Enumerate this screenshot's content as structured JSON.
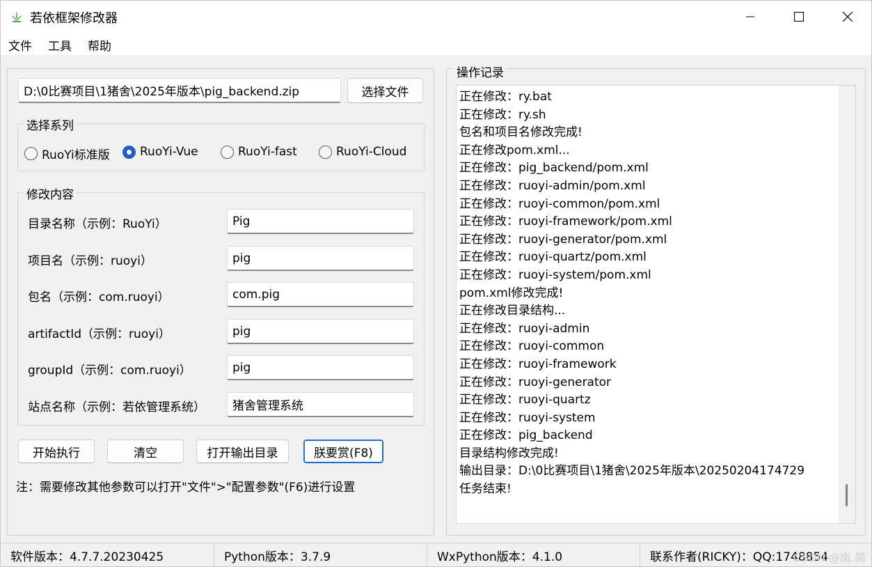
{
  "window": {
    "title": "若依框架修改器"
  },
  "menu": [
    "文件",
    "工具",
    "帮助"
  ],
  "file_path": "D:\\0比赛项目\\1猪舍\\2025年版本\\pig_backend.zip",
  "select_file_button": "选择文件",
  "series": {
    "legend": "选择系列",
    "options": [
      "RuoYi标准版",
      "RuoYi-Vue",
      "RuoYi-fast",
      "RuoYi-Cloud"
    ],
    "selected": "RuoYi-Vue"
  },
  "modify": {
    "legend": "修改内容",
    "fields": [
      {
        "label": "目录名称（示例：RuoYi）",
        "value": "Pig"
      },
      {
        "label": "项目名（示例：ruoyi）",
        "value": "pig"
      },
      {
        "label": "包名（示例：com.ruoyi）",
        "value": "com.pig"
      },
      {
        "label": "artifactId（示例：ruoyi）",
        "value": "pig"
      },
      {
        "label": "groupId（示例：com.ruoyi）",
        "value": "pig"
      },
      {
        "label": "站点名称（示例：若依管理系统）",
        "value": "猪舍管理系统"
      }
    ]
  },
  "actions": {
    "start": "开始执行",
    "clear": "清空",
    "open_output": "打开输出目录",
    "donate": "朕要赏(F8)"
  },
  "note": "注：需要修改其他参数可以打开\"文件\">\"配置参数\"(F6)进行设置",
  "log": {
    "legend": "操作记录",
    "lines": [
      "正在修改：ry.bat",
      "正在修改：ry.sh",
      "包名和项目名修改完成!",
      "正在修改pom.xml...",
      "正在修改：pig_backend/pom.xml",
      "正在修改：ruoyi-admin/pom.xml",
      "正在修改：ruoyi-common/pom.xml",
      "正在修改：ruoyi-framework/pom.xml",
      "正在修改：ruoyi-generator/pom.xml",
      "正在修改：ruoyi-quartz/pom.xml",
      "正在修改：ruoyi-system/pom.xml",
      "pom.xml修改完成!",
      "正在修改目录结构...",
      "正在修改：ruoyi-admin",
      "正在修改：ruoyi-common",
      "正在修改：ruoyi-framework",
      "正在修改：ruoyi-generator",
      "正在修改：ruoyi-quartz",
      "正在修改：ruoyi-system",
      "正在修改：pig_backend",
      "目录结构修改完成!",
      "输出目录：D:\\0比赛项目\\1猪舍\\2025年版本\\20250204174729",
      "任务结束!"
    ]
  },
  "status": {
    "software_version": "软件版本：4.7.7.20230425",
    "python_version": "Python版本：3.7.9",
    "wxpython_version": "WxPython版本：4.1.0",
    "contact": "联系作者(RICKY)：QQ:1748854",
    "watermark": "CSDN @南.简"
  },
  "colors": {
    "accent": "#1f5fbf",
    "icon_green": "#3a9a3a"
  }
}
